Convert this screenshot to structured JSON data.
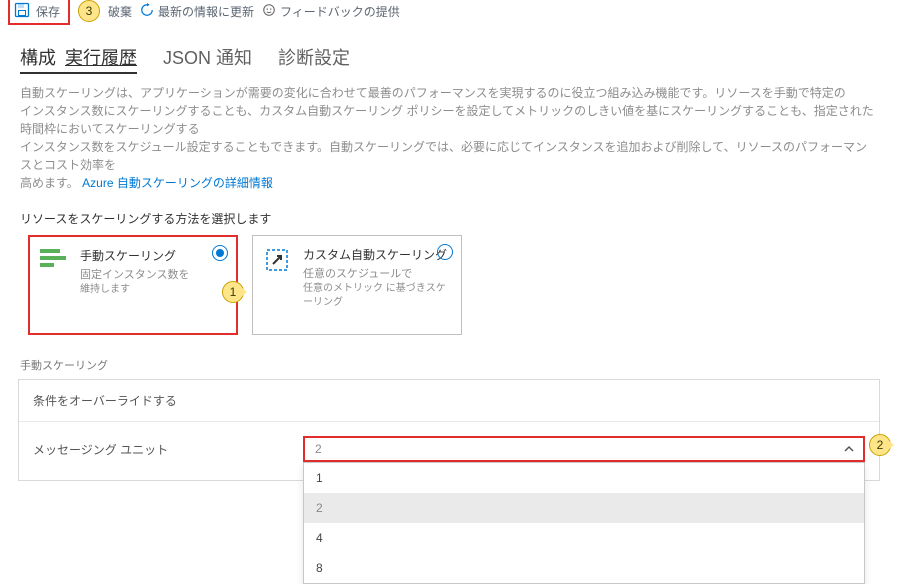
{
  "toolbar": {
    "save_label": "保存",
    "callout3": "3",
    "discard_label": "破棄",
    "refresh_label": "最新の情報に更新",
    "feedback_label": "フィードバックの提供"
  },
  "tabs": {
    "configure": "構成",
    "run_history": "実行履歴",
    "json_notify": "JSON 通知",
    "diagnostics": "診断設定"
  },
  "intro": {
    "line1": "自動スケーリングは、アプリケーションが需要の変化に合わせて最善のパフォーマンスを実現するのに役立つ組み込み機能です。リソースを手動で特定の",
    "line2": "インスタンス数にスケーリングすることも、カスタム自動スケーリング ポリシーを設定してメトリックのしきい値を基にスケーリングすることも、指定された時間枠においてスケーリングする",
    "line3": "インスタンス数をスケジュール設定することもできます。自動スケーリングでは、必要に応じてインスタンスを追加および削除して、リソースのパフォーマンスとコスト効率を",
    "line4_pre": "高めます。",
    "link": "Azure 自動スケーリングの詳細情報"
  },
  "section_label": "リソースをスケーリングする方法を選択します",
  "cards": {
    "manual": {
      "title": "手動スケーリング",
      "sub1": "固定インスタンス数を",
      "sub2": "維持します"
    },
    "custom": {
      "title": "カスタム自動スケーリング",
      "sub1": "任意のスケジュールで",
      "sub2": "任意のメトリック に基づきスケーリング"
    },
    "callout1": "1"
  },
  "manual_section_heading": "手動スケーリング",
  "panel": {
    "header": "条件をオーバーライドする",
    "field_label": "メッセージング ユニット",
    "current": "2",
    "options": [
      "1",
      "2",
      "4",
      "8"
    ]
  },
  "callout2": "2"
}
